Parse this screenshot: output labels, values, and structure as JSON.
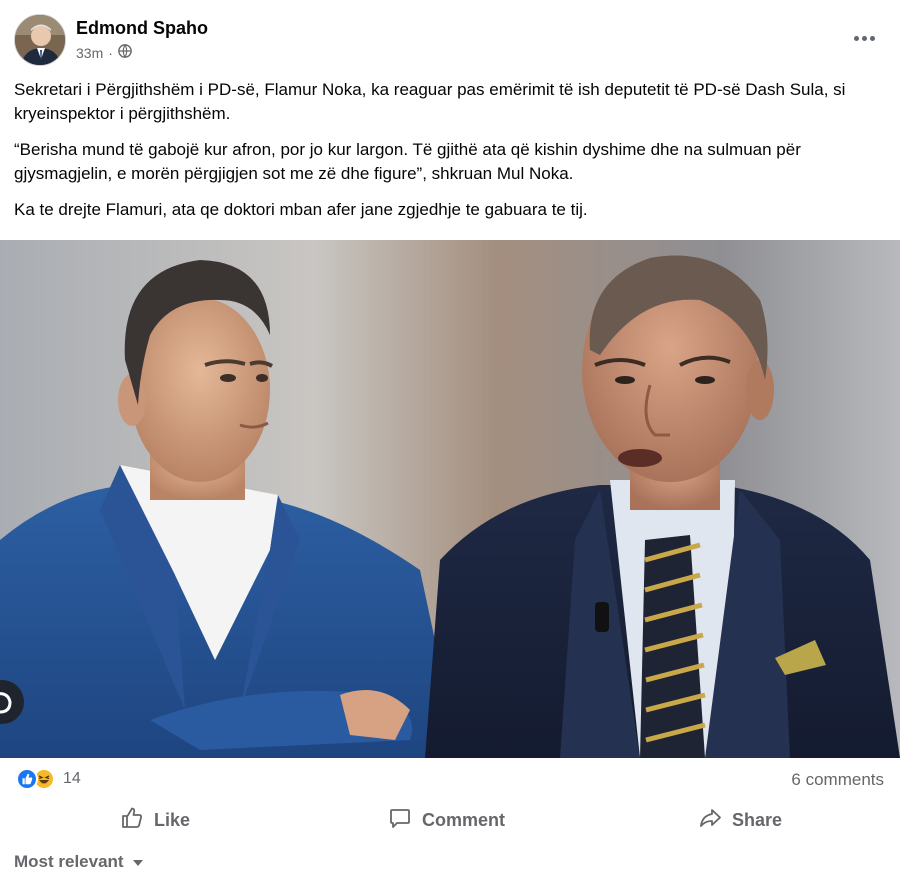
{
  "post": {
    "author": "Edmond Spaho",
    "time": "33m",
    "separator": "·",
    "privacy_icon": "globe-icon",
    "more_icon": "more-options-icon",
    "paragraphs": [
      "Sekretari i Përgjithshëm i PD-së, Flamur Noka, ka reaguar pas emërimit të ish deputetit të PD-së Dash Sula, si kryeinspektor i përgjithshëm.",
      "“Berisha mund të gabojë kur afron, por jo kur largon. Të gjithë ata që kishin dyshime dhe na sulmuan për gjysmagjelin, e morën përgjigjen sot me zë dhe figure”, shkruan Mul Noka.",
      "Ka te drejte Flamuri, ata qe doktori mban afer jane zgjedhje te gabuara te tij."
    ]
  },
  "stats": {
    "reaction_icons": [
      "like-reaction-icon",
      "haha-reaction-icon"
    ],
    "reaction_count": "14",
    "comments": "6 comments"
  },
  "actions": {
    "like": "Like",
    "comment": "Comment",
    "share": "Share"
  },
  "comments_sort": {
    "label": "Most relevant"
  },
  "colors": {
    "text": "#050505",
    "secondary": "#65676b",
    "brand_blue": "#1877f2",
    "haha_yellow": "#f7b928"
  }
}
